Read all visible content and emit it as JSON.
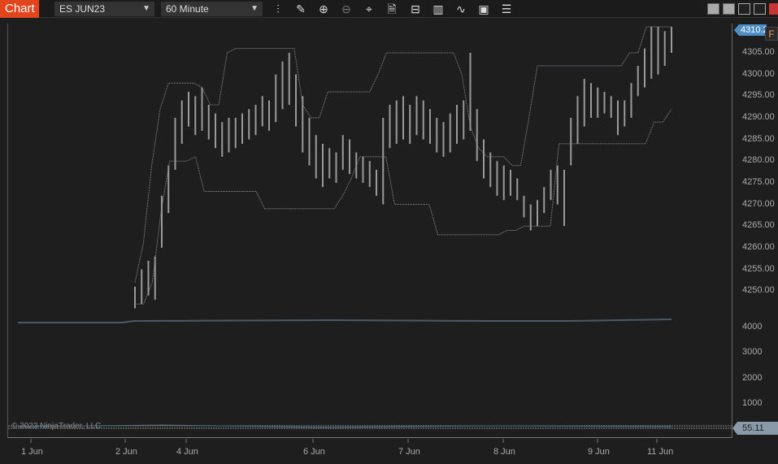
{
  "toolbar": {
    "tab": "Chart",
    "instrument": "ES JUN23",
    "interval": "60 Minute",
    "icons": [
      "bar-type-icon",
      "draw-icon",
      "zoom-in-icon",
      "zoom-out-icon",
      "crosshair-icon",
      "data-box-icon",
      "properties-icon",
      "chart-trader-icon",
      "indicators-icon",
      "strategies-icon",
      "menu-icon"
    ]
  },
  "price_axis": {
    "labels": [
      "4305.00",
      "4300.00",
      "4295.00",
      "4290.00",
      "4285.00",
      "4280.00",
      "4275.00",
      "4270.00",
      "4265.00",
      "4260.00",
      "4255.00",
      "4250.00"
    ],
    "current": "4310.2",
    "flag": "F"
  },
  "volume_axis": {
    "labels": [
      "4000",
      "3000",
      "2000",
      "1000"
    ]
  },
  "indicator": {
    "value": "55.11"
  },
  "time_axis": [
    "1 Jun",
    "2 Jun",
    "4 Jun",
    "6 Jun",
    "7 Jun",
    "8 Jun",
    "9 Jun",
    "11 Jun"
  ],
  "copyright": "© 2023 NinjaTrader, LLC",
  "colors": {
    "accent": "#e2451b",
    "flag": "#4d8fc4",
    "bars": "#9a9a9a",
    "channel": "#8a8f99"
  },
  "bars": [
    [
      4246,
      4251
    ],
    [
      4247,
      4255
    ],
    [
      4249,
      4257
    ],
    [
      4248,
      4258
    ],
    [
      4260,
      4272
    ],
    [
      4268,
      4279
    ],
    [
      4278,
      4290
    ],
    [
      4284,
      4294
    ],
    [
      4288,
      4296
    ],
    [
      4286,
      4295
    ],
    [
      4287,
      4297
    ],
    [
      4285,
      4293
    ],
    [
      4283,
      4291
    ],
    [
      4281,
      4289
    ],
    [
      4282,
      4290
    ],
    [
      4283,
      4290
    ],
    [
      4284,
      4291
    ],
    [
      4285,
      4292
    ],
    [
      4286,
      4293
    ],
    [
      4288,
      4295
    ],
    [
      4287,
      4294
    ],
    [
      4289,
      4300
    ],
    [
      4292,
      4303
    ],
    [
      4293,
      4305
    ],
    [
      4288,
      4300
    ],
    [
      4282,
      4295
    ],
    [
      4279,
      4290
    ],
    [
      4276,
      4286
    ],
    [
      4274,
      4284
    ],
    [
      4276,
      4283
    ],
    [
      4275,
      4282
    ],
    [
      4278,
      4286
    ],
    [
      4277,
      4285
    ],
    [
      4276,
      4282
    ],
    [
      4275,
      4281
    ],
    [
      4274,
      4280
    ],
    [
      4272,
      4278
    ],
    [
      4270,
      4290
    ],
    [
      4283,
      4293
    ],
    [
      4284,
      4294
    ],
    [
      4285,
      4295
    ],
    [
      4284,
      4293
    ],
    [
      4286,
      4295
    ],
    [
      4285,
      4294
    ],
    [
      4284,
      4292
    ],
    [
      4282,
      4290
    ],
    [
      4281,
      4289
    ],
    [
      4282,
      4291
    ],
    [
      4284,
      4293
    ],
    [
      4285,
      4294
    ],
    [
      4287,
      4305
    ],
    [
      4280,
      4292
    ],
    [
      4276,
      4285
    ],
    [
      4274,
      4282
    ],
    [
      4272,
      4280
    ],
    [
      4271,
      4279
    ],
    [
      4272,
      4278
    ],
    [
      4271,
      4276
    ],
    [
      4267,
      4272
    ],
    [
      4264,
      4270
    ],
    [
      4265,
      4271
    ],
    [
      4268,
      4274
    ],
    [
      4271,
      4278
    ],
    [
      4270,
      4279
    ],
    [
      4265,
      4278
    ],
    [
      4279,
      4290
    ],
    [
      4284,
      4295
    ],
    [
      4288,
      4299
    ],
    [
      4290,
      4298
    ],
    [
      4290,
      4297
    ],
    [
      4291,
      4296
    ],
    [
      4290,
      4295
    ],
    [
      4286,
      4294
    ],
    [
      4288,
      4294
    ],
    [
      4290,
      4298
    ],
    [
      4295,
      4302
    ],
    [
      4297,
      4306
    ],
    [
      4299,
      4311
    ],
    [
      4300,
      4311
    ],
    [
      4302,
      4310
    ],
    [
      4305,
      4311
    ]
  ],
  "channel_upper": [
    4252,
    4261,
    4279,
    4292,
    4298,
    4298,
    4298,
    4298,
    4297,
    4293,
    4293,
    4305,
    4306,
    4306,
    4306,
    4306,
    4306,
    4306,
    4306,
    4306,
    4293,
    4290,
    4290,
    4296,
    4296,
    4296,
    4296,
    4296,
    4296,
    4300,
    4305,
    4305,
    4305,
    4305,
    4305,
    4305,
    4305,
    4305,
    4305,
    4300,
    4288,
    4283,
    4281,
    4281,
    4281,
    4279,
    4279,
    4290,
    4302,
    4302,
    4302,
    4302,
    4302,
    4302,
    4302,
    4302,
    4302,
    4302,
    4302,
    4305,
    4305,
    4311,
    4311,
    4311,
    4311
  ],
  "channel_lower": [
    4247,
    4247,
    4252,
    4268,
    4280,
    4280,
    4280,
    4281,
    4273,
    4273,
    4273,
    4273,
    4273,
    4273,
    4273,
    4269,
    4269,
    4269,
    4269,
    4269,
    4269,
    4269,
    4269,
    4269,
    4272,
    4276,
    4281,
    4281,
    4281,
    4281,
    4270,
    4270,
    4270,
    4270,
    4270,
    4263,
    4263,
    4263,
    4263,
    4263,
    4263,
    4263,
    4263,
    4264,
    4264,
    4265,
    4265,
    4265,
    4265,
    4284,
    4284,
    4284,
    4284,
    4284,
    4284,
    4284,
    4284,
    4284,
    4284,
    4284,
    4289,
    4289,
    4292
  ]
}
